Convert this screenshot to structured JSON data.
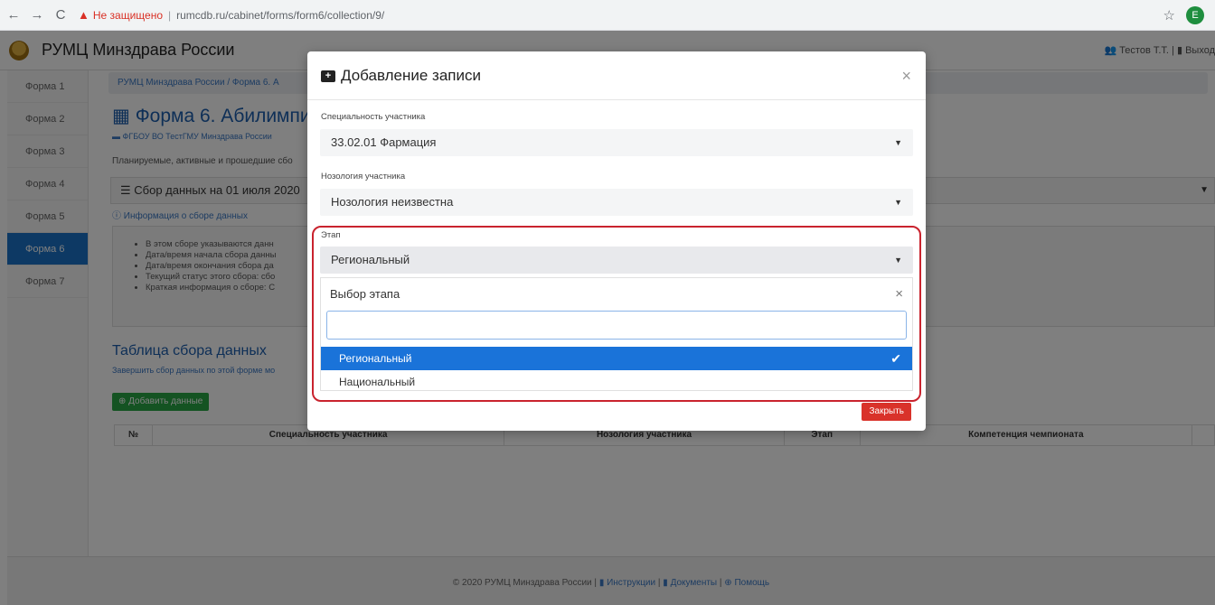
{
  "browser": {
    "back": "←",
    "forward": "→",
    "reload": "C",
    "security_label": "Не защищено",
    "url": "rumcdb.ru/cabinet/forms/form6/collection/9/",
    "star": "☆",
    "profile_initial": "E"
  },
  "app": {
    "title": "РУМЦ Минздрава России",
    "user_label": "Тестов Т.Т.",
    "logout_label": "Выход"
  },
  "sidebar": {
    "items": [
      {
        "label": "Форма 1"
      },
      {
        "label": "Форма 2"
      },
      {
        "label": "Форма 3"
      },
      {
        "label": "Форма 4"
      },
      {
        "label": "Форма 5"
      },
      {
        "label": "Форма 6"
      },
      {
        "label": "Форма 7"
      }
    ]
  },
  "page": {
    "breadcrumb": "РУМЦ Минздрава России / Форма 6. А",
    "form_title": "Форма 6. Абилимпи",
    "org": "ФГБОУ ВО ТестГМУ Минздрава России",
    "plan_text": "Планируемые, активные и прошедшие сбо",
    "collection": "Сбор данных на 01 июля 2020",
    "info_link": "Информация о сборе данных",
    "info_items": [
      "В этом сборе указываются данн",
      "Дата/время начала сбора данны",
      "Дата/время окончания сбора да",
      "Текущий статус этого сбора: сбо",
      "Краткая информация о сборе: С"
    ],
    "table_title": "Таблица сбора данных",
    "table_sub": "Завершить сбор данных по этой форме мо",
    "add_button": "Добавить данные",
    "columns": [
      "№",
      "Специальность участника",
      "Нозология участника",
      "Этап",
      "Компетенция чемпионата"
    ],
    "footer": {
      "copyright": "© 2020 РУМЦ Минздрава России",
      "links": [
        "Инструкции",
        "Документы",
        "Помощь"
      ]
    }
  },
  "modal": {
    "title": "Добавление записи",
    "specialty_label": "Специальность участника",
    "specialty_value": "33.02.01 Фармация",
    "nosology_label": "Нозология участника",
    "nosology_value": "Нозология неизвестна",
    "stage_label": "Этап",
    "stage_value": "Региональный",
    "dropdown_header": "Выбор этапа",
    "search_value": "",
    "options": [
      {
        "label": "Региональный",
        "selected": true
      },
      {
        "label": "Национальный",
        "selected": false
      }
    ],
    "close_button": "Закрыть"
  },
  "colors": {
    "accent": "#1a73d9",
    "danger": "#d9322a",
    "highlight_frame": "#c9232e",
    "success": "#28a745"
  }
}
